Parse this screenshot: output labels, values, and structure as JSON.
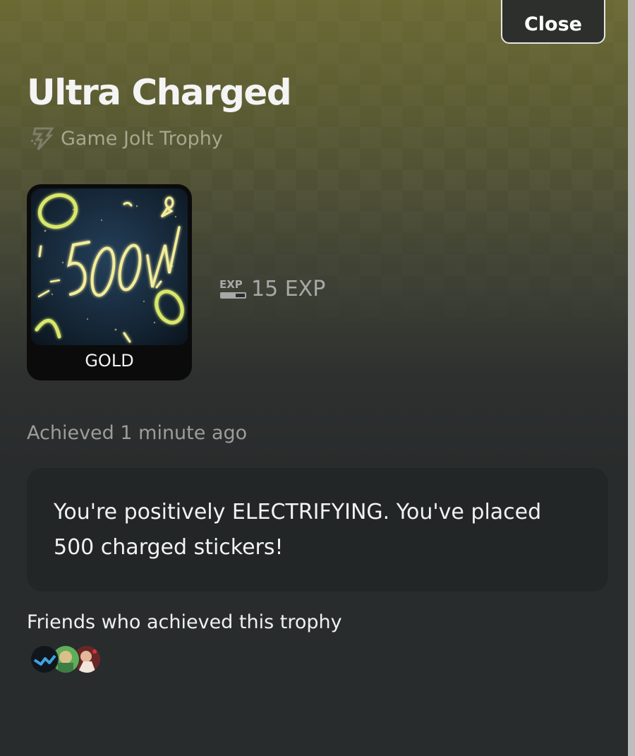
{
  "header": {
    "close_label": "Close"
  },
  "trophy": {
    "title": "Ultra Charged",
    "source_label": "Game Jolt Trophy",
    "source_icon": "game-jolt-bolt-icon",
    "tier": "GOLD",
    "exp_icon_text": "EXP",
    "exp_value": "15 EXP",
    "achieved": "Achieved 1 minute ago",
    "description": "You're positively ELECTRIFYING. You've placed 500 charged stickers!"
  },
  "friends": {
    "label": "Friends who achieved this trophy",
    "avatars": [
      "avatar-blue-bird",
      "avatar-green",
      "avatar-red"
    ]
  },
  "colors": {
    "tier_gold": "#e8e07a",
    "background_top": "#6b6a34",
    "background_bottom": "#292c2c",
    "description_bg": "#232626"
  }
}
